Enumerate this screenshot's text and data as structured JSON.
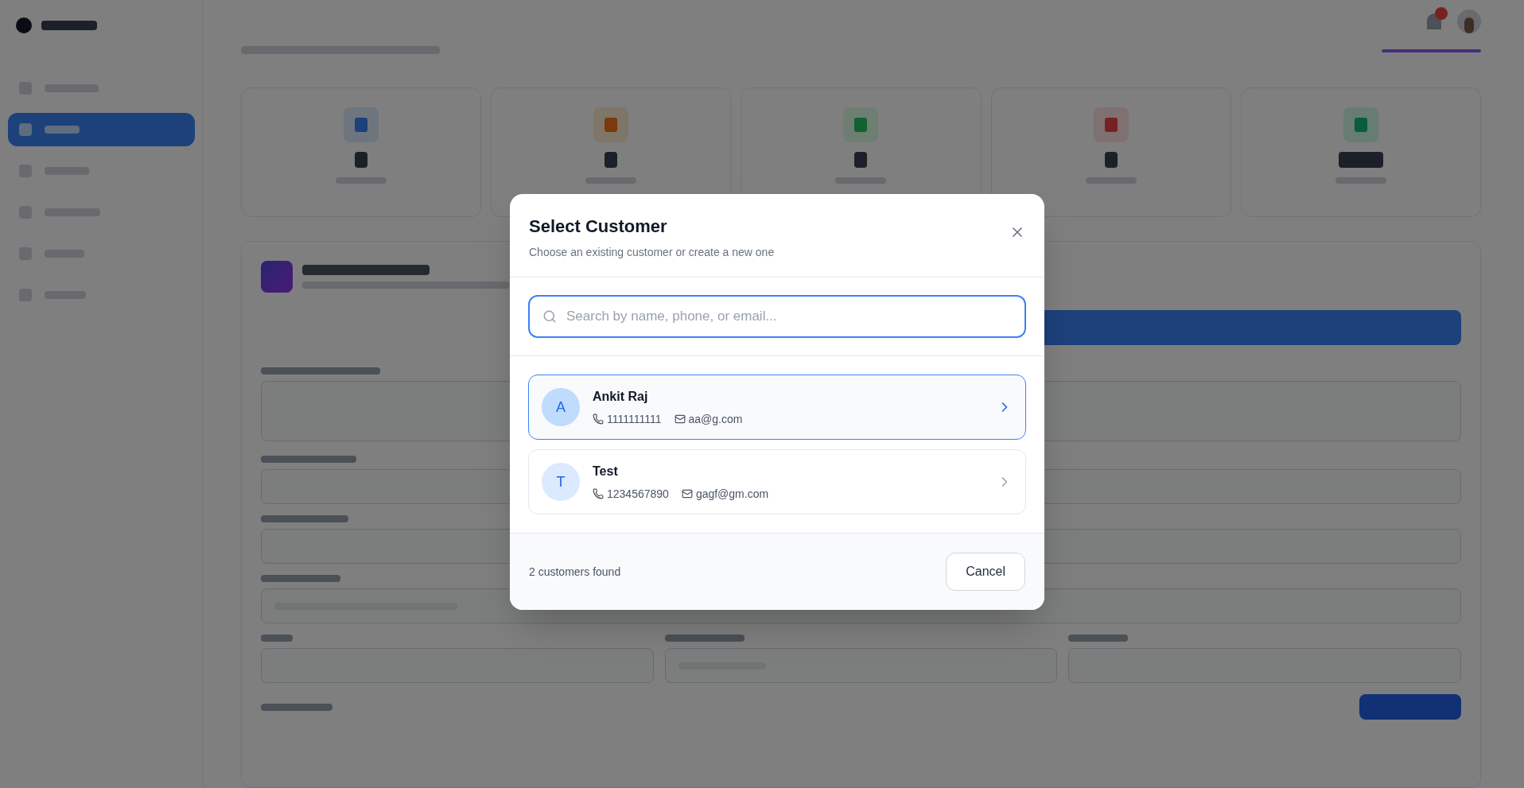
{
  "sidebar": {
    "items": [
      {
        "selected": false
      },
      {
        "selected": true
      },
      {
        "selected": false
      },
      {
        "selected": false
      },
      {
        "selected": false
      },
      {
        "selected": false
      }
    ]
  },
  "modal": {
    "title": "Select Customer",
    "subtitle": "Choose an existing customer or create a new one",
    "search_placeholder": "Search by name, phone, or email...",
    "customers": [
      {
        "initial": "A",
        "name": "Ankit Raj",
        "phone": "1111111111",
        "email": "aa@g.com",
        "selected": true
      },
      {
        "initial": "T",
        "name": "Test",
        "phone": "1234567890",
        "email": "gagf@gm.com",
        "selected": false
      }
    ],
    "count": "2 customers found",
    "cancel": "Cancel"
  }
}
